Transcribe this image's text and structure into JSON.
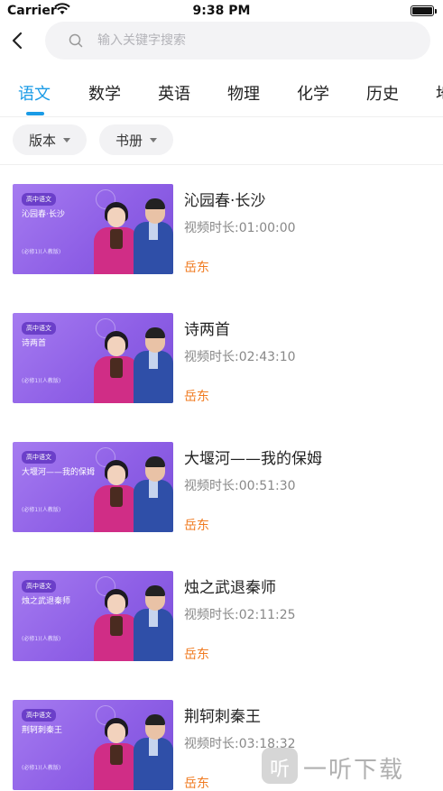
{
  "status_bar": {
    "carrier": "Carrier",
    "time": "9:38 PM"
  },
  "search": {
    "placeholder": "输入关键字搜索",
    "value": ""
  },
  "tabs": [
    {
      "label": "语文",
      "active": true
    },
    {
      "label": "数学",
      "active": false
    },
    {
      "label": "英语",
      "active": false
    },
    {
      "label": "物理",
      "active": false
    },
    {
      "label": "化学",
      "active": false
    },
    {
      "label": "历史",
      "active": false
    },
    {
      "label": "地",
      "active": false
    }
  ],
  "filters": [
    {
      "label": "版本"
    },
    {
      "label": "书册"
    }
  ],
  "videos": [
    {
      "thumb_badge": "高中语文",
      "thumb_title": "沁园春·长沙",
      "thumb_sub": "(必修1)(人教版)",
      "title": "沁园春·长沙",
      "duration": "视频时长:01:00:00",
      "author": "岳东"
    },
    {
      "thumb_badge": "高中语文",
      "thumb_title": "诗两首",
      "thumb_sub": "(必修1)(人教版)",
      "title": "诗两首",
      "duration": "视频时长:02:43:10",
      "author": "岳东"
    },
    {
      "thumb_badge": "高中语文",
      "thumb_title": "大堰河——我的保姆",
      "thumb_sub": "(必修1)(人教版)",
      "title": "大堰河——我的保姆",
      "duration": "视频时长:00:51:30",
      "author": "岳东"
    },
    {
      "thumb_badge": "高中语文",
      "thumb_title": "烛之武退秦师",
      "thumb_sub": "(必修1)(人教版)",
      "title": "烛之武退秦师",
      "duration": "视频时长:02:11:25",
      "author": "岳东"
    },
    {
      "thumb_badge": "高中语文",
      "thumb_title": "荆轲刺秦王",
      "thumb_sub": "(必修1)(人教版)",
      "title": "荆轲刺秦王",
      "duration": "视频时长:03:18:32",
      "author": "岳东"
    }
  ],
  "watermark": {
    "logo_glyph": "听",
    "text": "一听下载"
  },
  "colors": {
    "accent": "#1a9be6",
    "author": "#f07b21",
    "thumb_purple": "#8e5fe6"
  }
}
